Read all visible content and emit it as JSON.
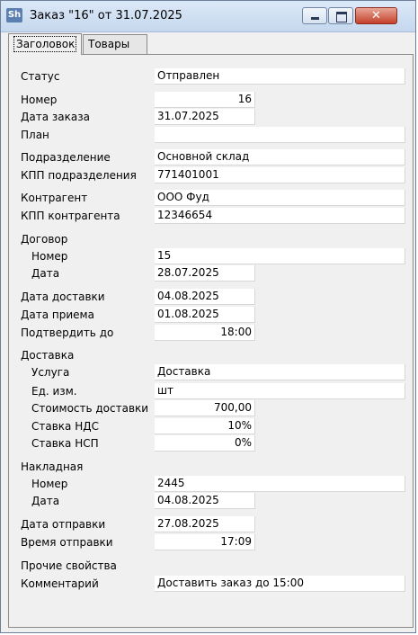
{
  "window": {
    "title": "Заказ \"16\" от 31.07.2025",
    "icon_name": "app-icon",
    "icon_text": "Sh"
  },
  "tabs": [
    {
      "label": "Заголовок",
      "active": true
    },
    {
      "label": "Товары",
      "active": false
    }
  ],
  "form": {
    "status": {
      "label": "Статус",
      "value": "Отправлен"
    },
    "number": {
      "label": "Номер",
      "value": "16"
    },
    "order_date": {
      "label": "Дата заказа",
      "value": "31.07.2025"
    },
    "plan": {
      "label": "План",
      "value": ""
    },
    "division": {
      "label": "Подразделение",
      "value": "Основной склад"
    },
    "division_kpp": {
      "label": "КПП подразделения",
      "value": "771401001"
    },
    "counterparty": {
      "label": "Контрагент",
      "value": "ООО Фуд"
    },
    "counterparty_kpp": {
      "label": "КПП контрагента",
      "value": "12346654"
    },
    "contract": {
      "section": "Договор",
      "number": {
        "label": "Номер",
        "value": "15"
      },
      "date": {
        "label": "Дата",
        "value": "28.07.2025"
      }
    },
    "delivery_date": {
      "label": "Дата доставки",
      "value": "04.08.2025"
    },
    "accept_date": {
      "label": "Дата приема",
      "value": "01.08.2025"
    },
    "confirm_until": {
      "label": "Подтвердить до",
      "value": "18:00"
    },
    "delivery": {
      "section": "Доставка",
      "service": {
        "label": "Услуга",
        "value": "Доставка"
      },
      "unit": {
        "label": "Ед. изм.",
        "value": "шт"
      },
      "cost": {
        "label": "Стоимость доставки",
        "value": "700,00"
      },
      "vat": {
        "label": "Ставка НДС",
        "value": "10%"
      },
      "nsp": {
        "label": "Ставка НСП",
        "value": "0%"
      }
    },
    "invoice": {
      "section": "Накладная",
      "number": {
        "label": "Номер",
        "value": "2445"
      },
      "date": {
        "label": "Дата",
        "value": "04.08.2025"
      }
    },
    "ship_date": {
      "label": "Дата отправки",
      "value": "27.08.2025"
    },
    "ship_time": {
      "label": "Время отправки",
      "value": "17:09"
    },
    "other": {
      "section": "Прочие свойства"
    },
    "comment": {
      "label": "Комментарий",
      "value": "Доставить заказ до 15:00"
    }
  }
}
